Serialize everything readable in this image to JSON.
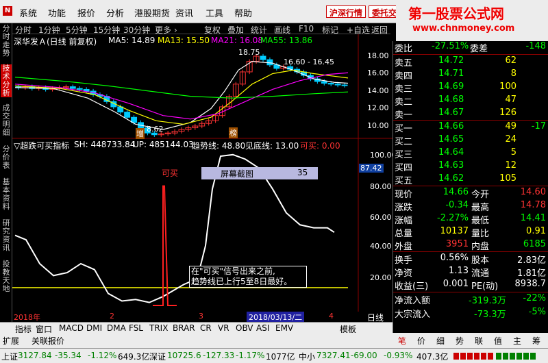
{
  "menu": {
    "app_icon": "N",
    "items": [
      "系统",
      "功能",
      "报价",
      "分析",
      "港股期货",
      "资讯",
      "工具",
      "帮助"
    ],
    "btn1": "沪深行情",
    "btn2": "委托交"
  },
  "logo": {
    "title": "第一股票公式网",
    "url": "www.chnmoney.com"
  },
  "left_tabs": [
    "分时走势",
    "技术分析",
    "成交明细",
    "分价表",
    "基本资料",
    "研究资讯",
    "投教天地"
  ],
  "toolbar": {
    "left": [
      "分时",
      "1分钟",
      "5分钟",
      "15分钟",
      "30分钟",
      "更多 ›"
    ],
    "right": [
      "复权",
      "叠加",
      "统计",
      "画线",
      "F10",
      "标记",
      "+自选",
      "返回"
    ]
  },
  "main_chart": {
    "title": "深华发Ａ(日线 前复权)",
    "ma5": "MA5: 14.89",
    "ma13": "MA13: 15.50",
    "ma21": "MA21: 16.08",
    "ma55": "MA55: 13.86",
    "annot_high": "18.75",
    "annot_range": "16.60 - 16.45",
    "annot_low": "8.62",
    "label_zeng": "增",
    "label_ban": "榜",
    "y_labels": [
      "18.00",
      "16.00",
      "14.00",
      "12.00",
      "10.00"
    ],
    "colors": {
      "ma5": "#ffffff",
      "ma13": "#ffff00",
      "ma21": "#ff00ff",
      "ma55": "#00ff00"
    }
  },
  "indicator": {
    "title": "▽超跌可买指标",
    "sh": "SH: 448733.84",
    "up": "UP: 485144.03",
    "trend": "趋势线: 48.80",
    "bottom": "见底线: 13.00",
    "buy": "可买: 0.00",
    "buy_signal": "可买",
    "screenshot_label": "屏幕截图",
    "screenshot_num": "35",
    "current_value": "87.42",
    "note_line1": "在\"可买\"信号出来之前,",
    "note_line2": "趋势线已上行5至8日最好。",
    "y_labels": [
      "100.00",
      "80.00",
      "60.00",
      "40.00",
      "20.00"
    ]
  },
  "date_bar": {
    "year": "2018年",
    "m2": "2",
    "m3": "3",
    "date": "2018/03/13/二",
    "m4": "4",
    "period": "日线"
  },
  "indicator_tabs": [
    "指标",
    "窗口",
    "MACD",
    "DMI",
    "DMA",
    "FSL",
    "TRIX",
    "BRAR",
    "CR",
    "VR",
    "OBV",
    "ASI",
    "EMV"
  ],
  "indicator_tabs_right": "模板",
  "bottom_tabs": [
    "扩展",
    "关联报价"
  ],
  "right_tabs": [
    "笔",
    "价",
    "细",
    "势",
    "联",
    "值",
    "主",
    "筹"
  ],
  "quote": {
    "wb_label": "委比",
    "wb_val": "-27.51%",
    "wc_label": "委差",
    "wc_val": "-148",
    "asks": [
      {
        "label": "卖五",
        "price": "14.72",
        "vol": "62",
        "chg": ""
      },
      {
        "label": "卖四",
        "price": "14.71",
        "vol": "8",
        "chg": ""
      },
      {
        "label": "卖三",
        "price": "14.69",
        "vol": "100",
        "chg": ""
      },
      {
        "label": "卖二",
        "price": "14.68",
        "vol": "47",
        "chg": ""
      },
      {
        "label": "卖一",
        "price": "14.67",
        "vol": "126",
        "chg": ""
      }
    ],
    "bids": [
      {
        "label": "买一",
        "price": "14.66",
        "vol": "49",
        "chg": "-17"
      },
      {
        "label": "买二",
        "price": "14.65",
        "vol": "24",
        "chg": ""
      },
      {
        "label": "买三",
        "price": "14.64",
        "vol": "5",
        "chg": ""
      },
      {
        "label": "买四",
        "price": "14.63",
        "vol": "12",
        "chg": ""
      },
      {
        "label": "买五",
        "price": "14.62",
        "vol": "105",
        "chg": ""
      }
    ],
    "stats": [
      {
        "l1": "现价",
        "v1": "14.66",
        "l2": "今开",
        "v2": "14.60",
        "c1": "grn",
        "c2": "red"
      },
      {
        "l1": "涨跌",
        "v1": "-0.34",
        "l2": "最高",
        "v2": "14.78",
        "c1": "grn",
        "c2": "red"
      },
      {
        "l1": "涨幅",
        "v1": "-2.27%",
        "l2": "最低",
        "v2": "14.41",
        "c1": "grn",
        "c2": "grn"
      },
      {
        "l1": "总量",
        "v1": "10137",
        "l2": "量比",
        "v2": "0.91",
        "c1": "yel",
        "c2": "yel"
      },
      {
        "l1": "外盘",
        "v1": "3951",
        "l2": "内盘",
        "v2": "6185",
        "c1": "red",
        "c2": "grn"
      }
    ],
    "stats2": [
      {
        "l1": "换手",
        "v1": "0.56%",
        "l2": "股本",
        "v2": "2.83亿"
      },
      {
        "l1": "净资",
        "v1": "1.13",
        "l2": "流通",
        "v2": "1.81亿"
      },
      {
        "l1": "收益(三)",
        "v1": "0.001",
        "l2": "PE(动)",
        "v2": "8938.7"
      }
    ],
    "netflow_label": "净流入额",
    "netflow_val": "-319.3万",
    "netflow_pct": "-22%",
    "block_label": "大宗流入",
    "block_val": "-73.3万",
    "block_pct": "-5%"
  },
  "status": {
    "sh_label": "上证",
    "sh_val": "3127.84",
    "sh_chg": "-35.34",
    "sh_pct": "-1.12%",
    "sh_amt": "649.3亿",
    "sz_label": "深证",
    "sz_val": "10725.6",
    "sz_chg": "-127.33",
    "sz_pct": "-1.17%",
    "sz_amt": "1077亿",
    "zx_label": "中小",
    "zx_val": "7327.41",
    "zx_chg": "-69.00",
    "zx_pct": "-0.93%",
    "zx_amt": "407.3亿"
  }
}
